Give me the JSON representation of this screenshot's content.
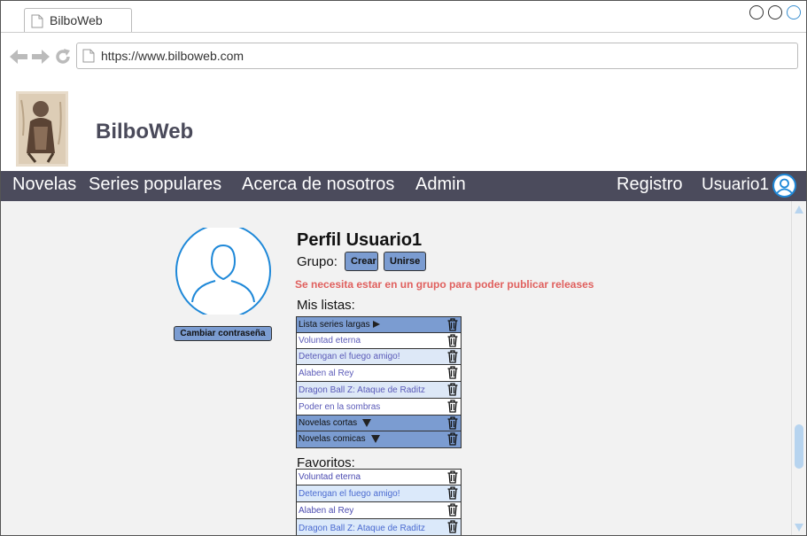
{
  "browser": {
    "tab_title": "BilboWeb",
    "url": "https://www.bilboweb.com"
  },
  "site": {
    "title": "BilboWeb"
  },
  "menu": {
    "novelas": "Novelas",
    "series_populares": "Series populares",
    "acerca": "Acerca de nosotros",
    "admin": "Admin",
    "registro": "Registro",
    "usuario": "Usuario1"
  },
  "profile": {
    "title": "Perfil Usuario1",
    "grupo_label": "Grupo:",
    "crear_label": "Crear",
    "unirse_label": "Unirse",
    "warning": "Se necesita estar en un grupo para poder publicar releases",
    "cambiar_label": "Cambiar contraseña"
  },
  "listas": {
    "label": "Mis listas:",
    "items": [
      "Lista series largas",
      "Voluntad eterna",
      "Detengan el fuego amigo!",
      "Alaben al Rey",
      "Dragon Ball Z: Ataque de Raditz",
      "Poder en la sombras",
      "Novelas cortas",
      "Novelas comicas"
    ]
  },
  "favoritos": {
    "label": "Favoritos:",
    "items": [
      "Voluntad eterna",
      "Detengan el fuego amigo!",
      "Alaben al Rey",
      "Dragon Ball Z: Ataque de Raditz"
    ]
  },
  "colors": {
    "menubar": "#4b4b5c",
    "button": "#7b9cd1",
    "warning": "#e0605e",
    "accent": "#1e88d8"
  },
  "icons": {
    "tab": "document-icon",
    "back": "back-arrow-icon",
    "forward": "forward-arrow-icon",
    "reload": "reload-icon",
    "user": "user-circle-icon",
    "delete": "trash-icon"
  }
}
